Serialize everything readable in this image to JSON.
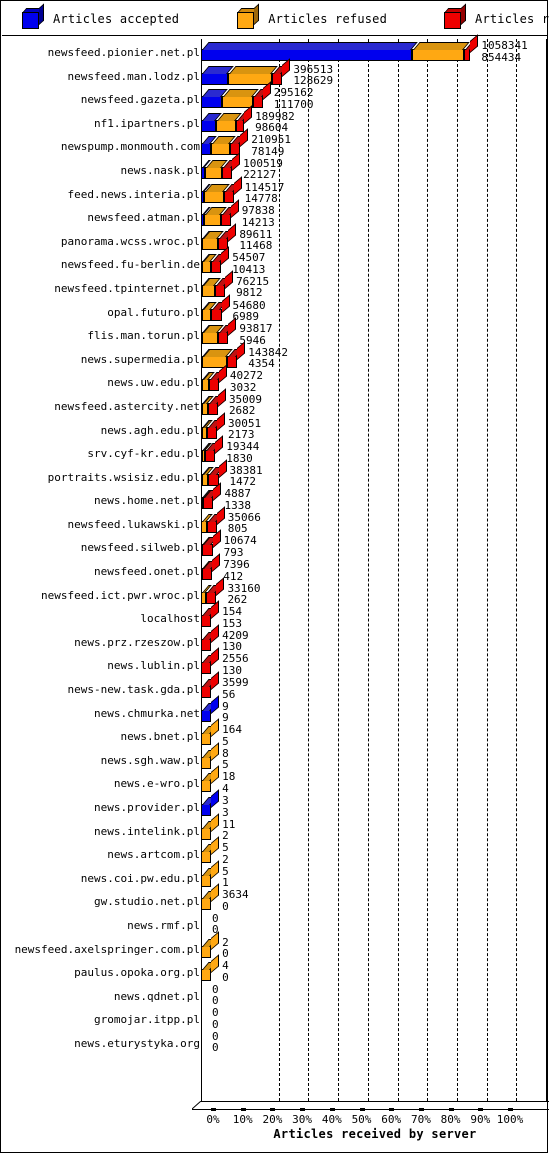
{
  "legend": {
    "items": [
      {
        "label": "Articles accepted",
        "color": "#0000ee",
        "icon": "cube-icon"
      },
      {
        "label": "Articles refused",
        "color": "#ffa812",
        "icon": "cube-icon"
      },
      {
        "label": "Articles rejected",
        "color": "#ee0000",
        "icon": "cube-icon"
      }
    ]
  },
  "axis": {
    "title": "Articles received by server",
    "ticks": [
      "0%",
      "10%",
      "20%",
      "30%",
      "40%",
      "50%",
      "60%",
      "70%",
      "80%",
      "90%",
      "100%"
    ]
  },
  "chart_data": {
    "type": "bar",
    "orientation": "horizontal",
    "stacked": true,
    "title": "",
    "xlabel": "Articles received by server",
    "ylabel": "",
    "xlim": [
      0,
      100
    ],
    "xunit": "%",
    "grid": true,
    "legend_position": "top",
    "series": [
      "Articles accepted",
      "Articles refused",
      "Articles rejected"
    ],
    "series_colors": [
      "#0000ee",
      "#ffa812",
      "#ee0000"
    ],
    "categories": [
      "newsfeed.pionier.net.pl",
      "newsfeed.man.lodz.pl",
      "newsfeed.gazeta.pl",
      "nf1.ipartners.pl",
      "newspump.monmouth.com",
      "news.nask.pl",
      "feed.news.interia.pl",
      "newsfeed.atman.pl",
      "panorama.wcss.wroc.pl",
      "newsfeed.fu-berlin.de",
      "newsfeed.tpinternet.pl",
      "opal.futuro.pl",
      "flis.man.torun.pl",
      "news.supermedia.pl",
      "news.uw.edu.pl",
      "newsfeed.astercity.net",
      "news.agh.edu.pl",
      "srv.cyf-kr.edu.pl",
      "portraits.wsisiz.edu.pl",
      "news.home.net.pl",
      "newsfeed.lukawski.pl",
      "newsfeed.silweb.pl",
      "newsfeed.onet.pl",
      "newsfeed.ict.pwr.wroc.pl",
      "localhost",
      "news.prz.rzeszow.pl",
      "news.lublin.pl",
      "news-new.task.gda.pl",
      "news.chmurka.net",
      "news.bnet.pl",
      "news.sgh.waw.pl",
      "news.e-wro.pl",
      "news.provider.pl",
      "news.intelink.pl",
      "news.artcom.pl",
      "news.coi.pw.edu.pl",
      "gw.studio.net.pl",
      "news.rmf.pl",
      "newsfeed.axelspringer.com.pl",
      "paulus.opoka.org.pl",
      "news.qdnet.pl",
      "gromojar.itpp.pl",
      "news.eturystyka.org"
    ],
    "rows": [
      {
        "label": "newsfeed.pionier.net.pl",
        "value_top": "1058341",
        "value_bottom": "854434",
        "accepted": 71.0,
        "refused": 17.5,
        "rejected": 2.2
      },
      {
        "label": "newsfeed.man.lodz.pl",
        "value_top": "396513",
        "value_bottom": "128629",
        "accepted": 9.2,
        "refused": 14.8,
        "rejected": 3.4
      },
      {
        "label": "newsfeed.gazeta.pl",
        "value_top": "295162",
        "value_bottom": "111700",
        "accepted": 7.0,
        "refused": 10.4,
        "rejected": 3.4
      },
      {
        "label": "nf1.ipartners.pl",
        "value_top": "189982",
        "value_bottom": "98604",
        "accepted": 5.2,
        "refused": 6.6,
        "rejected": 2.7
      },
      {
        "label": "newspump.monmouth.com",
        "value_top": "210951",
        "value_bottom": "78149",
        "accepted": 3.4,
        "refused": 6.4,
        "rejected": 3.4
      },
      {
        "label": "news.nask.pl",
        "value_top": "100519",
        "value_bottom": "22127",
        "accepted": 1.3,
        "refused": 5.8,
        "rejected": 3.4
      },
      {
        "label": "feed.news.interia.pl",
        "value_top": "114517",
        "value_bottom": "14778",
        "accepted": 1.0,
        "refused": 6.6,
        "rejected": 3.4
      },
      {
        "label": "newsfeed.atman.pl",
        "value_top": "97838",
        "value_bottom": "14213",
        "accepted": 1.0,
        "refused": 5.6,
        "rejected": 3.4
      },
      {
        "label": "panorama.wcss.wroc.pl",
        "value_top": "89611",
        "value_bottom": "11468",
        "accepted": 0.5,
        "refused": 5.3,
        "rejected": 3.4
      },
      {
        "label": "newsfeed.fu-berlin.de",
        "value_top": "54507",
        "value_bottom": "10413",
        "accepted": 0.4,
        "refused": 3.0,
        "rejected": 3.4
      },
      {
        "label": "newsfeed.tpinternet.pl",
        "value_top": "76215",
        "value_bottom": "9812",
        "accepted": 0.3,
        "refused": 4.3,
        "rejected": 3.4
      },
      {
        "label": "opal.futuro.pl",
        "value_top": "54680",
        "value_bottom": "6989",
        "accepted": 0.2,
        "refused": 3.1,
        "rejected": 3.4
      },
      {
        "label": "flis.man.torun.pl",
        "value_top": "93817",
        "value_bottom": "5946",
        "accepted": 0.2,
        "refused": 5.4,
        "rejected": 3.4
      },
      {
        "label": "news.supermedia.pl",
        "value_top": "143842",
        "value_bottom": "4354",
        "accepted": 0.2,
        "refused": 8.4,
        "rejected": 3.4
      },
      {
        "label": "news.uw.edu.pl",
        "value_top": "40272",
        "value_bottom": "3032",
        "accepted": 0.2,
        "refused": 2.2,
        "rejected": 3.4
      },
      {
        "label": "newsfeed.astercity.net",
        "value_top": "35009",
        "value_bottom": "2682",
        "accepted": 0.1,
        "refused": 1.9,
        "rejected": 3.4
      },
      {
        "label": "news.agh.edu.pl",
        "value_top": "30051",
        "value_bottom": "2173",
        "accepted": 0.1,
        "refused": 1.6,
        "rejected": 3.4
      },
      {
        "label": "srv.cyf-kr.edu.pl",
        "value_top": "19344",
        "value_bottom": "1830",
        "accepted": 0.1,
        "refused": 1.0,
        "rejected": 3.4
      },
      {
        "label": "portraits.wsisiz.edu.pl",
        "value_top": "38381",
        "value_bottom": "1472",
        "accepted": 0.1,
        "refused": 2.1,
        "rejected": 3.4
      },
      {
        "label": "news.home.net.pl",
        "value_top": "4887",
        "value_bottom": "1338",
        "accepted": 0.1,
        "refused": 0.1,
        "rejected": 3.4
      },
      {
        "label": "newsfeed.lukawski.pl",
        "value_top": "35066",
        "value_bottom": "805",
        "accepted": 0.0,
        "refused": 1.9,
        "rejected": 3.4
      },
      {
        "label": "newsfeed.silweb.pl",
        "value_top": "10674",
        "value_bottom": "793",
        "accepted": 0.0,
        "refused": 0.5,
        "rejected": 3.4
      },
      {
        "label": "newsfeed.onet.pl",
        "value_top": "7396",
        "value_bottom": "412",
        "accepted": 0.0,
        "refused": 0.3,
        "rejected": 3.4
      },
      {
        "label": "newsfeed.ict.pwr.wroc.pl",
        "value_top": "33160",
        "value_bottom": "262",
        "accepted": 0.0,
        "refused": 1.8,
        "rejected": 3.4
      },
      {
        "label": "localhost",
        "value_top": "154",
        "value_bottom": "153",
        "accepted": 0.0,
        "refused": 0.0,
        "rejected": 3.4
      },
      {
        "label": "news.prz.rzeszow.pl",
        "value_top": "4209",
        "value_bottom": "130",
        "accepted": 0.0,
        "refused": 0.0,
        "rejected": 3.4
      },
      {
        "label": "news.lublin.pl",
        "value_top": "2556",
        "value_bottom": "130",
        "accepted": 0.0,
        "refused": 0.0,
        "rejected": 3.4
      },
      {
        "label": "news-new.task.gda.pl",
        "value_top": "3599",
        "value_bottom": "56",
        "accepted": 0.0,
        "refused": 0.0,
        "rejected": 3.4
      },
      {
        "label": "news.chmurka.net",
        "value_top": "9",
        "value_bottom": "9",
        "accepted": 3.4,
        "refused": 0.0,
        "rejected": 0.0
      },
      {
        "label": "news.bnet.pl",
        "value_top": "164",
        "value_bottom": "5",
        "accepted": 0.0,
        "refused": 3.4,
        "rejected": 0.0
      },
      {
        "label": "news.sgh.waw.pl",
        "value_top": "8",
        "value_bottom": "5",
        "accepted": 0.0,
        "refused": 3.4,
        "rejected": 0.0
      },
      {
        "label": "news.e-wro.pl",
        "value_top": "18",
        "value_bottom": "4",
        "accepted": 0.0,
        "refused": 3.4,
        "rejected": 0.0
      },
      {
        "label": "news.provider.pl",
        "value_top": "3",
        "value_bottom": "3",
        "accepted": 3.4,
        "refused": 0.0,
        "rejected": 0.0
      },
      {
        "label": "news.intelink.pl",
        "value_top": "11",
        "value_bottom": "2",
        "accepted": 0.0,
        "refused": 3.4,
        "rejected": 0.0
      },
      {
        "label": "news.artcom.pl",
        "value_top": "5",
        "value_bottom": "2",
        "accepted": 0.0,
        "refused": 3.4,
        "rejected": 0.0
      },
      {
        "label": "news.coi.pw.edu.pl",
        "value_top": "5",
        "value_bottom": "1",
        "accepted": 0.0,
        "refused": 3.4,
        "rejected": 0.0
      },
      {
        "label": "gw.studio.net.pl",
        "value_top": "3634",
        "value_bottom": "0",
        "accepted": 0.0,
        "refused": 3.4,
        "rejected": 0.0
      },
      {
        "label": "news.rmf.pl",
        "value_top": "0",
        "value_bottom": "0",
        "accepted": 0.0,
        "refused": 0.0,
        "rejected": 0.0
      },
      {
        "label": "newsfeed.axelspringer.com.pl",
        "value_top": "2",
        "value_bottom": "0",
        "accepted": 0.0,
        "refused": 3.4,
        "rejected": 0.0
      },
      {
        "label": "paulus.opoka.org.pl",
        "value_top": "4",
        "value_bottom": "0",
        "accepted": 0.0,
        "refused": 3.4,
        "rejected": 0.0
      },
      {
        "label": "news.qdnet.pl",
        "value_top": "0",
        "value_bottom": "0",
        "accepted": 0.0,
        "refused": 0.0,
        "rejected": 0.0
      },
      {
        "label": "gromojar.itpp.pl",
        "value_top": "0",
        "value_bottom": "0",
        "accepted": 0.0,
        "refused": 0.0,
        "rejected": 0.0
      },
      {
        "label": "news.eturystyka.org",
        "value_top": "0",
        "value_bottom": "0",
        "accepted": 0.0,
        "refused": 0.0,
        "rejected": 0.0
      }
    ]
  }
}
